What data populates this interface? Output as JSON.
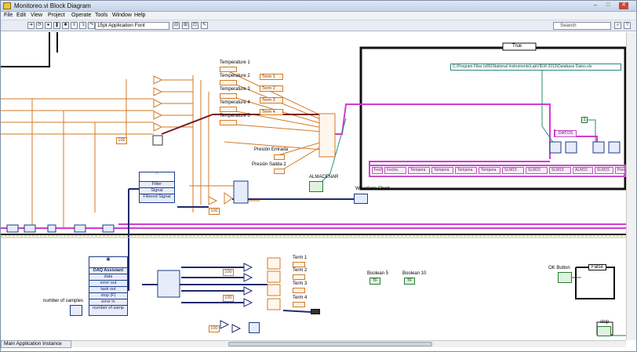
{
  "window": {
    "title": "Monitoreo.vi Block Diagram",
    "controls": {
      "minimize": "–",
      "maximize": "□",
      "close": "✕"
    }
  },
  "menu": [
    "File",
    "Edit",
    "View",
    "Project",
    "Operate",
    "Tools",
    "Window",
    "Help"
  ],
  "toolbar": {
    "font_select": "15pt Application Font",
    "search_placeholder": "Search"
  },
  "diagram": {
    "temperature_labels": [
      "Temperature 1",
      "Temperature 2",
      "Temperature 3",
      "Temperature 4",
      "Temperature 5"
    ],
    "term_labels_top": [
      "Term 1",
      "Term 2",
      "Term 3",
      "Term 4"
    ],
    "presion_entrada": "Presión Entrada",
    "presion_salida": "Presión Salida 2",
    "almacenar": "ALMACENAR",
    "waveform_chart": "Waveform Chart",
    "filter_title": "Filter",
    "filter_signal": "Signal",
    "filter_filtered": "Filtered Signal",
    "const_100": "100",
    "case_selector": "True",
    "file_path": "C:\\Program Files (x86)\\National Instruments\\LabVIEW 2013\\Database Datos.xls",
    "datos": "DATOS",
    "bundle_items": [
      "Fecha",
      "Tempera",
      "Tempera",
      "Tempera",
      "Tempera",
      "Tempera",
      "SLM15",
      "SLM15",
      "SLM15",
      "ALM15",
      "SLM15",
      "Pres"
    ],
    "daq_title": "DAQ Assistant",
    "daq_ports": [
      "data",
      "error out",
      "task out",
      "stop (F)",
      "error in",
      "number of samp"
    ],
    "number_of_samples": "number of samples",
    "term_labels_bottom": [
      "Term 1",
      "Term 2",
      "Term 3",
      "Term 4"
    ],
    "boolean5": "Boolean 5",
    "boolean10": "Boolean 10",
    "ok_button": "OK Button",
    "false_case": "False",
    "stop": "stop",
    "const_1": "1",
    "tf": "TF"
  },
  "status_bar": {
    "target": "Main Application Instance"
  }
}
